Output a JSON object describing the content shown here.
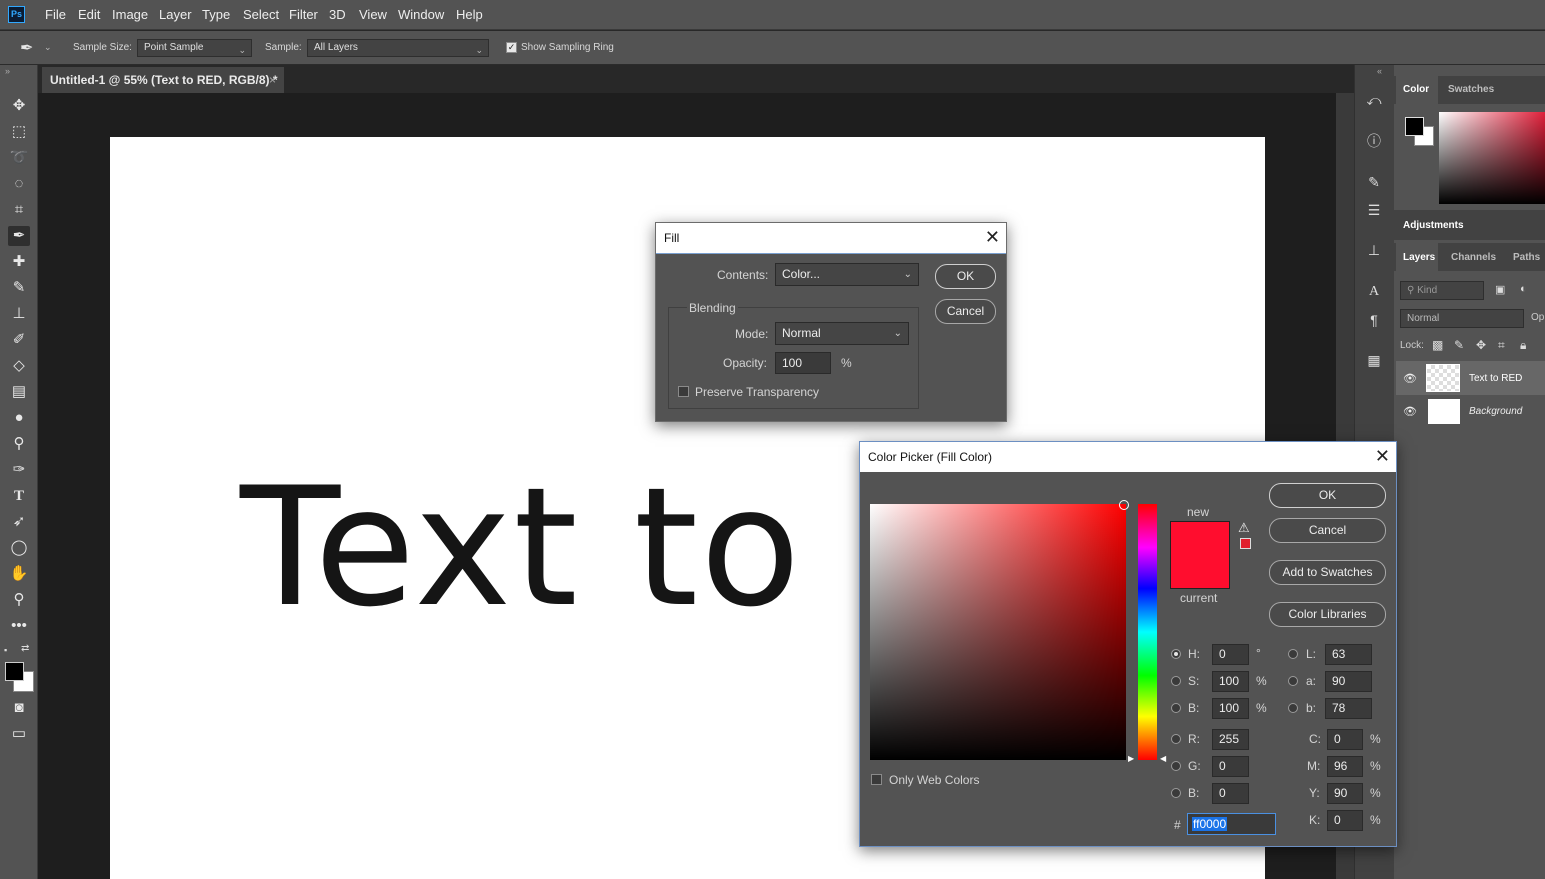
{
  "app": {
    "logo": "Ps"
  },
  "menu": [
    "File",
    "Edit",
    "Image",
    "Layer",
    "Type",
    "Select",
    "Filter",
    "3D",
    "View",
    "Window",
    "Help"
  ],
  "options": {
    "sample_size_label": "Sample Size:",
    "sample_size_value": "Point Sample",
    "sample_label": "Sample:",
    "sample_value": "All Layers",
    "show_ring_label": "Show Sampling Ring",
    "show_ring_checked": true
  },
  "tools": [
    "move-icon",
    "marquee-icon",
    "lasso-icon",
    "quick-select-icon",
    "crop-icon",
    "eyedropper-icon",
    "healing-icon",
    "brush-icon",
    "stamp-icon",
    "history-brush-icon",
    "eraser-icon",
    "gradient-icon",
    "blur-icon",
    "dodge-icon",
    "pen-icon",
    "type-icon",
    "path-select-icon",
    "ellipse-icon",
    "hand-icon",
    "zoom-icon",
    "more-icon"
  ],
  "document": {
    "tab_title": "Untitled-1 @ 55% (Text to RED, RGB/8) *",
    "tab_close": "×",
    "canvas_text": "Text to R"
  },
  "panels": {
    "color_tab": "Color",
    "swatches_tab": "Swatches",
    "adjustments_tab": "Adjustments",
    "layers_tab": "Layers",
    "channels_tab": "Channels",
    "paths_tab": "Paths",
    "kind_placeholder": "Kind",
    "blend_mode": "Normal",
    "opacity_short": "Op",
    "lock_label": "Lock:",
    "layers": [
      {
        "name": "Text to RED",
        "italic": false,
        "selected": true
      },
      {
        "name": "Background",
        "italic": true,
        "selected": false
      }
    ]
  },
  "fill_dialog": {
    "title": "Fill",
    "close": "✕",
    "contents_label": "Contents:",
    "contents_value": "Color...",
    "blending_group": "Blending",
    "mode_label": "Mode:",
    "mode_value": "Normal",
    "opacity_label": "Opacity:",
    "opacity_value": "100",
    "opacity_unit": "%",
    "preserve_label": "Preserve Transparency",
    "preserve_checked": false,
    "ok": "OK",
    "cancel": "Cancel"
  },
  "picker_dialog": {
    "title": "Color Picker (Fill Color)",
    "close": "✕",
    "new_label": "new",
    "current_label": "current",
    "ok": "OK",
    "cancel": "Cancel",
    "add_swatches": "Add to Swatches",
    "color_libraries": "Color Libraries",
    "only_web_label": "Only Web Colors",
    "only_web_checked": false,
    "hsb": [
      {
        "label": "H:",
        "value": "0",
        "unit": "°",
        "selected": true
      },
      {
        "label": "S:",
        "value": "100",
        "unit": "%",
        "selected": false
      },
      {
        "label": "B:",
        "value": "100",
        "unit": "%",
        "selected": false
      }
    ],
    "lab": [
      {
        "label": "L:",
        "value": "63"
      },
      {
        "label": "a:",
        "value": "90"
      },
      {
        "label": "b:",
        "value": "78"
      }
    ],
    "rgb": [
      {
        "label": "R:",
        "value": "255"
      },
      {
        "label": "G:",
        "value": "0"
      },
      {
        "label": "B:",
        "value": "0"
      }
    ],
    "cmyk": [
      {
        "label": "C:",
        "value": "0",
        "unit": "%"
      },
      {
        "label": "M:",
        "value": "96",
        "unit": "%"
      },
      {
        "label": "Y:",
        "value": "90",
        "unit": "%"
      },
      {
        "label": "K:",
        "value": "0",
        "unit": "%"
      }
    ],
    "hex_label": "#",
    "hex_value": "ff0000",
    "new_color": "#ff0d2e",
    "warning_swatch": "#e0202e"
  },
  "colors": {
    "accent": "#31a8ff",
    "selected_red": "#ff0000"
  }
}
